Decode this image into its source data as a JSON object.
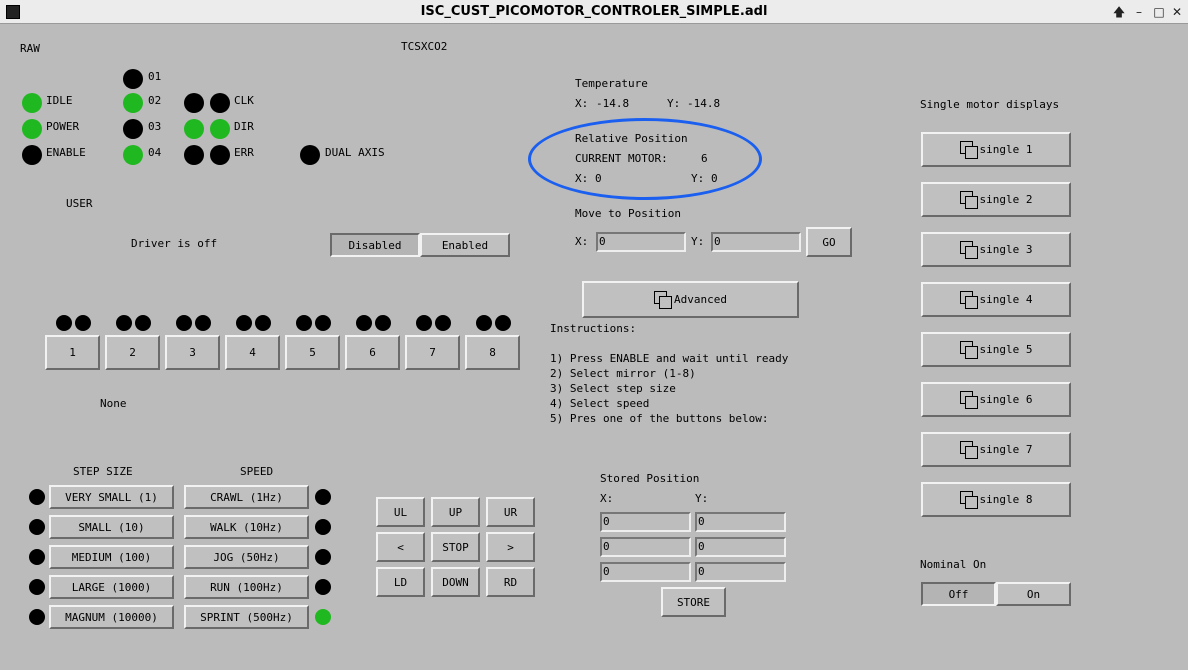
{
  "window": {
    "title": "ISC_CUST_PICOMOTOR_CONTROLER_SIMPLE.adl",
    "btn_up": "🡅",
    "btn_min": "–",
    "btn_max": "□",
    "btn_close": "✕"
  },
  "raw_label": "RAW",
  "device_label": "TCSXCO2",
  "status": {
    "idle": "IDLE",
    "power": "POWER",
    "enable": "ENABLE"
  },
  "channels": [
    "01",
    "02",
    "03",
    "04"
  ],
  "flags": {
    "clk": "CLK",
    "dir": "DIR",
    "err": "ERR",
    "dual_axis": "DUAL AXIS"
  },
  "user_label": "USER",
  "driver_status": "Driver is off",
  "driver_toggle": {
    "disabled": "Disabled",
    "enabled": "Enabled"
  },
  "motors": [
    "1",
    "2",
    "3",
    "4",
    "5",
    "6",
    "7",
    "8"
  ],
  "selected_motor_text": "None",
  "step_size": {
    "header": "STEP SIZE",
    "options": [
      "VERY SMALL (1)",
      "SMALL (10)",
      "MEDIUM (100)",
      "LARGE (1000)",
      "MAGNUM (10000)"
    ]
  },
  "speed": {
    "header": "SPEED",
    "options": [
      "CRAWL (1Hz)",
      "WALK (10Hz)",
      "JOG (50Hz)",
      "RUN (100Hz)",
      "SPRINT (500Hz)"
    ]
  },
  "jog_pad": {
    "ul": "UL",
    "up": "UP",
    "ur": "UR",
    "left": "<",
    "stop": "STOP",
    "right": ">",
    "ld": "LD",
    "down": "DOWN",
    "rd": "RD"
  },
  "temperature": {
    "header": "Temperature",
    "x_label": "X:",
    "x_value": "-14.8",
    "y_label": "Y:",
    "y_value": "-14.8"
  },
  "relative_position": {
    "header": "Relative Position",
    "current_motor_label": "CURRENT MOTOR:",
    "current_motor_value": "6",
    "x_label": "X:",
    "x_value": "0",
    "y_label": "Y:",
    "y_value": "0"
  },
  "move_to_position": {
    "header": "Move to Position",
    "x_label": "X:",
    "x_value": "0",
    "y_label": "Y:",
    "y_value": "0",
    "go_label": "GO"
  },
  "advanced_label": "Advanced",
  "instructions": {
    "header": "Instructions:",
    "lines": [
      "1) Press ENABLE and wait until ready",
      "2) Select mirror (1-8)",
      "3) Select step size",
      "4) Select speed",
      "5) Pres one of the buttons below:"
    ]
  },
  "stored_position": {
    "header": "Stored Position",
    "x_label": "X:",
    "y_label": "Y:",
    "rows": [
      {
        "x": "0",
        "y": "0"
      },
      {
        "x": "0",
        "y": "0"
      },
      {
        "x": "0",
        "y": "0"
      }
    ],
    "store_label": "STORE"
  },
  "single_motor": {
    "header": "Single motor displays",
    "buttons": [
      "single 1",
      "single 2",
      "single 3",
      "single 4",
      "single 5",
      "single 6",
      "single 7",
      "single 8"
    ]
  },
  "nominal": {
    "header": "Nominal On",
    "off": "Off",
    "on": "On"
  },
  "colors": {
    "background": "#bbbbbb",
    "led_on": "#20b820",
    "led_off": "#000000",
    "highlight": "#1a5ff0"
  }
}
